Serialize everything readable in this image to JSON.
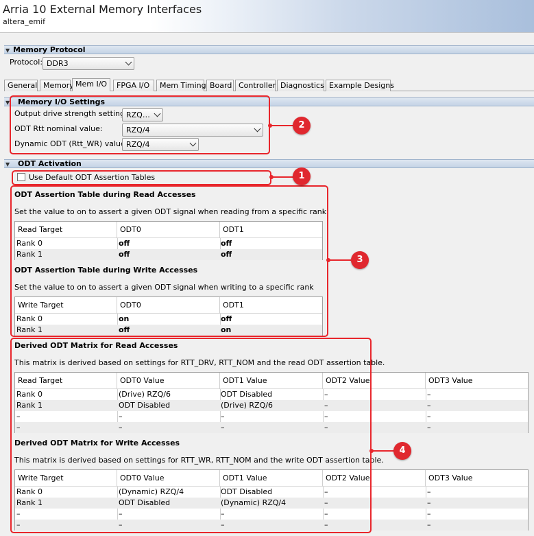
{
  "header": {
    "title": "Arria 10 External Memory Interfaces",
    "subtitle": "altera_emif"
  },
  "protocol_section": {
    "title": "Memory Protocol",
    "protocol_label": "Protocol:",
    "protocol_value": "DDR3"
  },
  "tabs": [
    "General",
    "Memory",
    "Mem I/O",
    "FPGA I/O",
    "Mem Timing",
    "Board",
    "Controller",
    "Diagnostics",
    "Example Designs"
  ],
  "active_tab": "Mem I/O",
  "io_settings": {
    "title": "Memory I/O Settings",
    "drive_label": "Output drive strength setting:",
    "drive_value": "RZQ…",
    "rtt_label": "ODT Rtt nominal value:",
    "rtt_value": "RZQ/4",
    "dyn_label": "Dynamic ODT (Rtt_WR) value:",
    "dyn_value": "RZQ/4"
  },
  "odt_activation": {
    "title": "ODT Activation",
    "default_checkbox_label": "Use Default ODT Assertion Tables",
    "default_checked": false
  },
  "read_assertion": {
    "title": "ODT Assertion Table during Read Accesses",
    "desc": "Set the value to on to assert a given ODT signal when reading from a specific rank",
    "headers": [
      "Read Target",
      "ODT0",
      "ODT1"
    ],
    "rows": [
      [
        "Rank 0",
        "off",
        "off"
      ],
      [
        "Rank 1",
        "off",
        "off"
      ]
    ]
  },
  "write_assertion": {
    "title": "ODT Assertion Table during Write Accesses",
    "desc": "Set the value to on to assert a given ODT signal when writing to a specific rank",
    "headers": [
      "Write Target",
      "ODT0",
      "ODT1"
    ],
    "rows": [
      [
        "Rank 0",
        "on",
        "off"
      ],
      [
        "Rank 1",
        "off",
        "on"
      ]
    ]
  },
  "read_matrix": {
    "title": "Derived ODT Matrix for Read Accesses",
    "desc": "This matrix is derived based on settings for RTT_DRV, RTT_NOM and the read ODT assertion table.",
    "headers": [
      "Read Target",
      "ODT0 Value",
      "ODT1 Value",
      "ODT2 Value",
      "ODT3 Value"
    ],
    "rows": [
      [
        "Rank 0",
        "(Drive) RZQ/6",
        "ODT Disabled",
        "–",
        "–"
      ],
      [
        "Rank 1",
        "ODT Disabled",
        "(Drive) RZQ/6",
        "–",
        "–"
      ],
      [
        "–",
        "–",
        "–",
        "–",
        "–"
      ],
      [
        "–",
        "–",
        "–",
        "–",
        "–"
      ]
    ]
  },
  "write_matrix": {
    "title": "Derived ODT Matrix for Write Accesses",
    "desc": "This matrix is derived based on settings for RTT_WR, RTT_NOM and the write ODT assertion table.",
    "headers": [
      "Write Target",
      "ODT0 Value",
      "ODT1 Value",
      "ODT2 Value",
      "ODT3 Value"
    ],
    "rows": [
      [
        "Rank 0",
        "(Dynamic) RZQ/4",
        "ODT Disabled",
        "–",
        "–"
      ],
      [
        "Rank 1",
        "ODT Disabled",
        "(Dynamic) RZQ/4",
        "–",
        "–"
      ],
      [
        "–",
        "–",
        "–",
        "–",
        "–"
      ],
      [
        "–",
        "–",
        "–",
        "–",
        "–"
      ]
    ]
  },
  "callouts": [
    "1",
    "2",
    "3",
    "4"
  ],
  "colors": {
    "callout": "#e0282f",
    "section_bar": "#c4d3e6"
  }
}
